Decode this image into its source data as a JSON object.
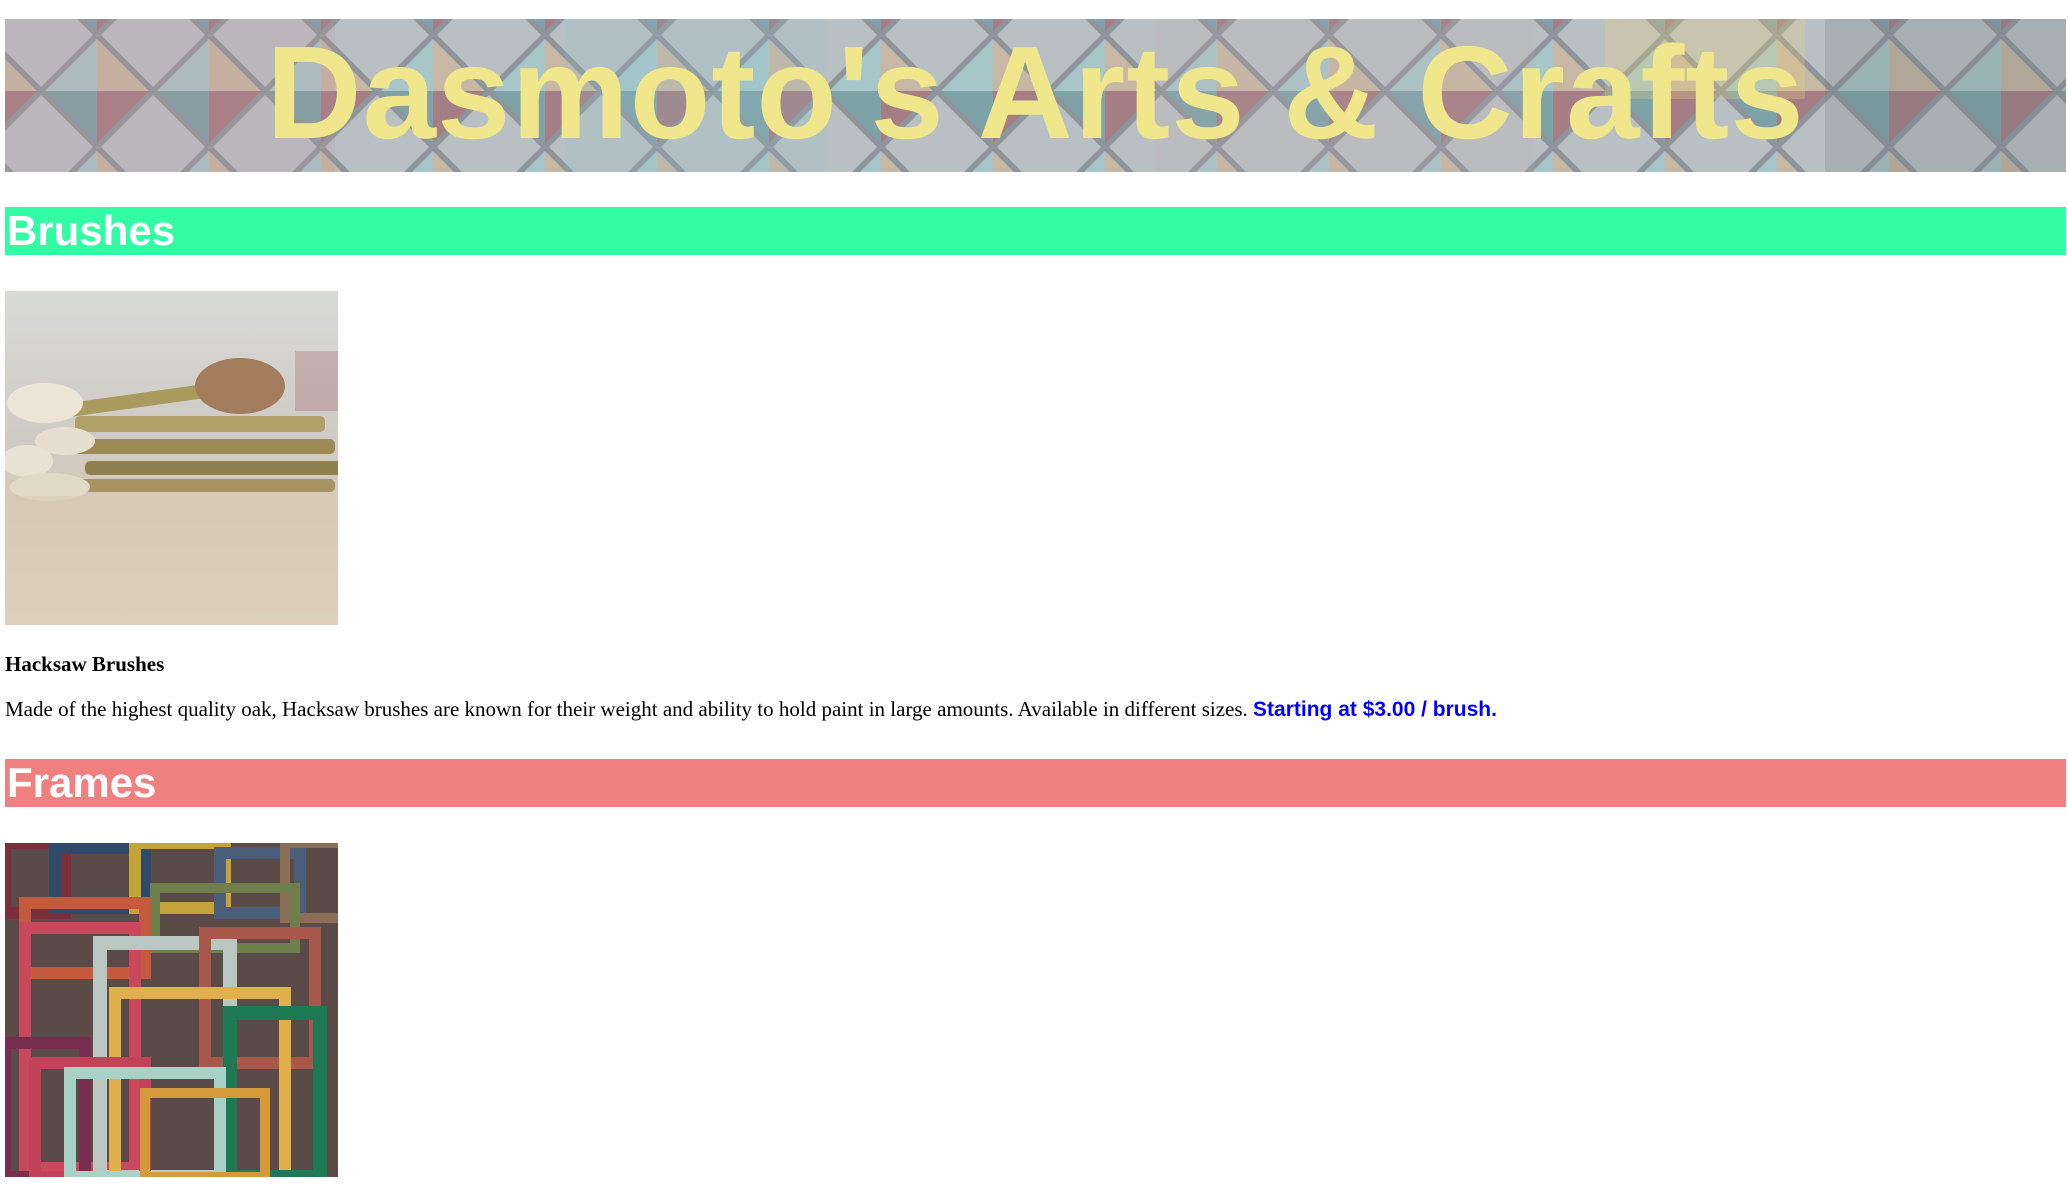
{
  "banner": {
    "title": "Dasmoto's Arts & Crafts",
    "title_color": "#f0e68c"
  },
  "sections": [
    {
      "heading": "Brushes",
      "heading_color": "#31fca4",
      "image": "paintbrushes-photo",
      "product_name": "Hacksaw Brushes",
      "description": "Made of the highest quality oak, Hacksaw brushes are known for their weight and ability to hold paint in large amounts. Available in different sizes.",
      "price": "Starting at $3.00 / brush.",
      "price_color": "#0000ff"
    },
    {
      "heading": "Frames",
      "heading_color": "#f08080",
      "image": "picture-frames-photo"
    }
  ]
}
